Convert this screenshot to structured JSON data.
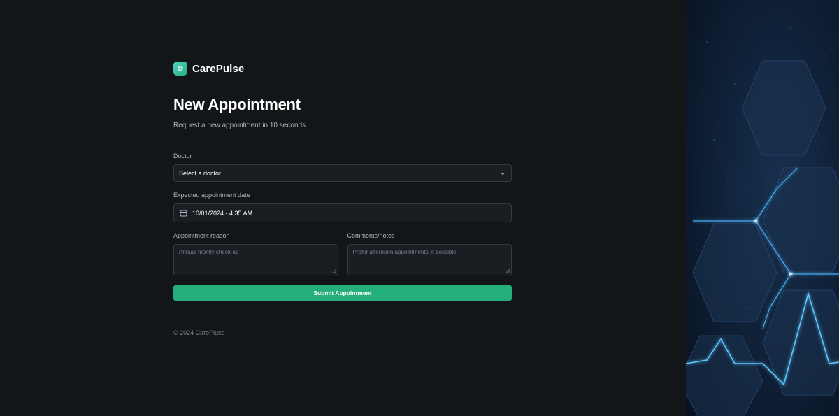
{
  "brand": {
    "name": "CarePulse",
    "icon": "carepulse-logo-icon"
  },
  "page": {
    "title": "New Appointment",
    "subtitle": "Request a new appointment in 10 seconds."
  },
  "form": {
    "doctor": {
      "label": "Doctor",
      "value": "Select a doctor"
    },
    "date": {
      "label": "Expected appointment date",
      "value": "10/01/2024 - 4:35 AM"
    },
    "reason": {
      "label": "Appointment reason",
      "placeholder": "Annual montly check-up"
    },
    "notes": {
      "label": "Comments/notes",
      "placeholder": "Prefer afternoon appointments, if possible"
    },
    "submit_label": "Submit Appointment"
  },
  "footer": {
    "copyright": "© 2024 CarePluse"
  },
  "colors": {
    "background": "#131619",
    "input_bg": "#1a1d21",
    "border": "#363a3d",
    "accent": "#24ae7c",
    "muted_text": "#abb8c4",
    "glow": "#4fb8ff"
  }
}
